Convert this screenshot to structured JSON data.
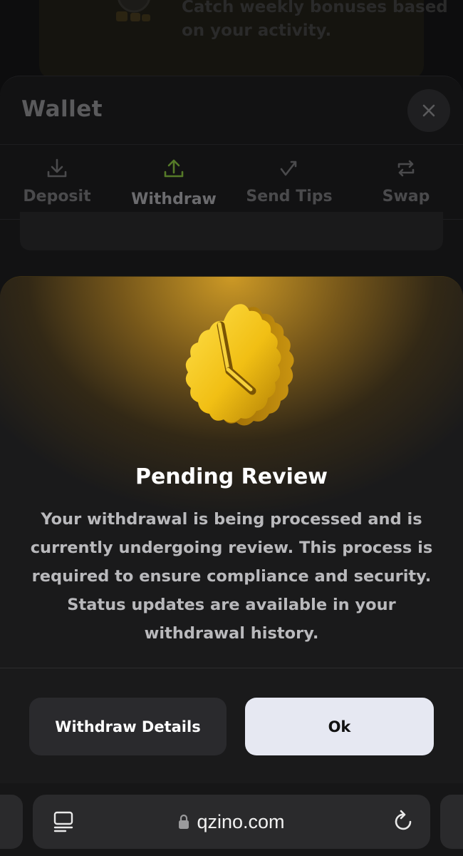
{
  "promo": {
    "text": "Catch weekly bonuses based on your activity."
  },
  "wallet": {
    "title": "Wallet",
    "tabs": [
      {
        "label": "Deposit",
        "icon": "download-icon",
        "active": false
      },
      {
        "label": "Withdraw",
        "icon": "upload-icon",
        "active": true
      },
      {
        "label": "Send Tips",
        "icon": "send-tips-icon",
        "active": false
      },
      {
        "label": "Swap",
        "icon": "swap-icon",
        "active": false
      }
    ],
    "accent_color": "#3f5d1d"
  },
  "modal": {
    "title": "Pending Review",
    "body": "Your withdrawal is being processed and is currently undergoing review. This process is required to ensure compliance and security. Status updates are available in your withdrawal history.",
    "buttons": {
      "details": "Withdraw Details",
      "ok": "Ok"
    },
    "badge_icon": "clock-badge-icon",
    "glow_color": "#d6a026"
  },
  "browser": {
    "url": "qzino.com"
  }
}
